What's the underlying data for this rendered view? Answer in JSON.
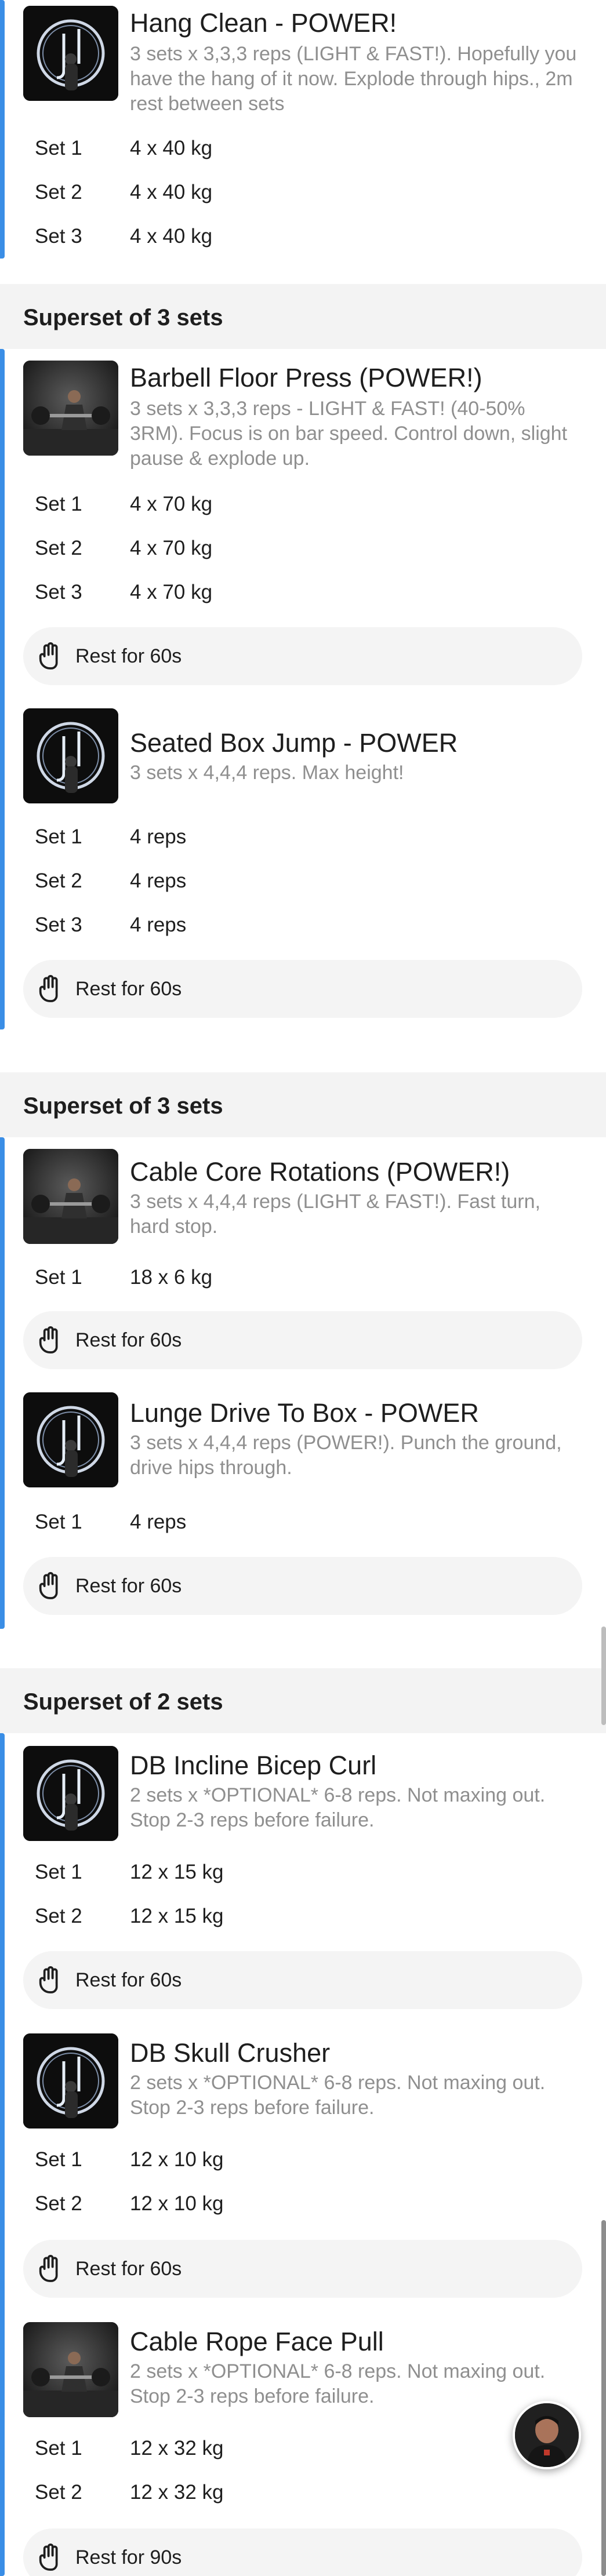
{
  "colors": {
    "accent": "#3a8ee6",
    "header_bg": "#f3f3f3",
    "rest_bg": "#f4f4f4",
    "desc": "#8f8f8f"
  },
  "rest_icon": "hand-stop-icon",
  "block1": {
    "exercises": [
      {
        "title": "Hang Clean - POWER!",
        "description": "3 sets x 3,3,3 reps (LIGHT & FAST!). Hopefully you have the hang of it now. Explode through hips., 2m rest between sets",
        "sets": [
          {
            "label": "Set 1",
            "value": "4 x 40 kg"
          },
          {
            "label": "Set 2",
            "value": "4 x 40 kg"
          },
          {
            "label": "Set 3",
            "value": "4 x 40 kg"
          }
        ]
      }
    ]
  },
  "block2": {
    "header": "Superset of 3 sets",
    "exercises": [
      {
        "title": "Barbell Floor Press (POWER!)",
        "description": "3 sets x 3,3,3 reps - LIGHT & FAST! (40-50% 3RM). Focus is on bar speed. Control down, slight pause & explode up.",
        "sets": [
          {
            "label": "Set 1",
            "value": "4 x 70 kg"
          },
          {
            "label": "Set 2",
            "value": "4 x 70 kg"
          },
          {
            "label": "Set 3",
            "value": "4 x 70 kg"
          }
        ],
        "rest": "Rest for 60s"
      },
      {
        "title": "Seated Box Jump - POWER",
        "description": "3 sets x 4,4,4 reps. Max height!",
        "sets": [
          {
            "label": "Set 1",
            "value": "4 reps"
          },
          {
            "label": "Set 2",
            "value": "4 reps"
          },
          {
            "label": "Set 3",
            "value": "4 reps"
          }
        ],
        "rest": "Rest for 60s"
      }
    ]
  },
  "block3": {
    "header": "Superset of 3 sets",
    "exercises": [
      {
        "title": "Cable Core Rotations (POWER!)",
        "description": "3 sets x 4,4,4 reps (LIGHT & FAST!). Fast turn, hard stop.",
        "sets": [
          {
            "label": "Set 1",
            "value": "18 x 6 kg"
          }
        ],
        "rest": "Rest for 60s"
      },
      {
        "title": "Lunge Drive To Box - POWER",
        "description": "3 sets x 4,4,4 reps (POWER!). Punch the ground, drive hips through.",
        "sets": [
          {
            "label": "Set 1",
            "value": "4 reps"
          }
        ],
        "rest": "Rest for 60s"
      }
    ]
  },
  "block4": {
    "header": "Superset of 2 sets",
    "exercises": [
      {
        "title": "DB Incline Bicep Curl",
        "description": "2 sets x *OPTIONAL* 6-8 reps. Not maxing out. Stop 2-3 reps before failure.",
        "sets": [
          {
            "label": "Set 1",
            "value": "12 x 15 kg"
          },
          {
            "label": "Set 2",
            "value": "12 x 15 kg"
          }
        ],
        "rest": "Rest for 60s"
      },
      {
        "title": "DB Skull Crusher",
        "description": "2 sets x *OPTIONAL* 6-8 reps. Not maxing out. Stop 2-3 reps before failure.",
        "sets": [
          {
            "label": "Set 1",
            "value": "12 x 10 kg"
          },
          {
            "label": "Set 2",
            "value": "12 x 10 kg"
          }
        ],
        "rest": "Rest for 60s"
      },
      {
        "title": "Cable Rope Face Pull",
        "description": "2 sets x *OPTIONAL* 6-8 reps. Not maxing out. Stop 2-3 reps before failure.",
        "sets": [
          {
            "label": "Set 1",
            "value": "12 x 32 kg"
          },
          {
            "label": "Set 2",
            "value": "12 x 32 kg"
          }
        ],
        "rest": "Rest for 90s"
      }
    ]
  }
}
